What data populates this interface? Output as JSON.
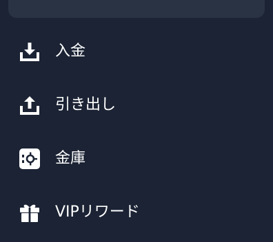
{
  "menu": {
    "items": [
      {
        "label": "入金",
        "icon": "deposit-icon"
      },
      {
        "label": "引き出し",
        "icon": "withdraw-icon"
      },
      {
        "label": "金庫",
        "icon": "vault-icon"
      },
      {
        "label": "VIPリワード",
        "icon": "gift-icon"
      }
    ]
  },
  "colors": {
    "background": "#1b2334",
    "card": "#2a3344",
    "text": "#ffffff"
  }
}
